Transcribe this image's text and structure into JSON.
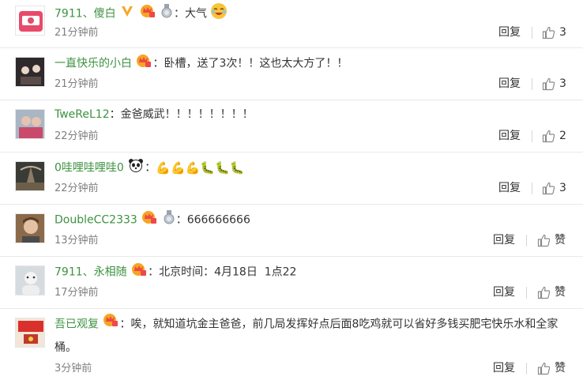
{
  "comments": [
    {
      "username": "7911、傻白",
      "separator": "：",
      "text": "大气",
      "time": "21分钟前",
      "reply_label": "回复",
      "like_count": "3"
    },
    {
      "username": "一直快乐的小白",
      "separator": "：",
      "text": "卧槽，送了3次！！这也太大方了！！",
      "time": "21分钟前",
      "reply_label": "回复",
      "like_count": "3"
    },
    {
      "username": "TweReL12",
      "separator": "：",
      "text": "金爸威武！！！！！！！！",
      "time": "22分钟前",
      "reply_label": "回复",
      "like_count": "2"
    },
    {
      "username": "0哇哩哇哩哇0",
      "separator": "：",
      "text": "",
      "emoji_text": "💪💪💪🐛🐛🐛",
      "time": "22分钟前",
      "reply_label": "回复",
      "like_count": "3"
    },
    {
      "username": "DoubleCC2333",
      "separator": "：",
      "text": "666666666",
      "time": "13分钟前",
      "reply_label": "回复",
      "like_count": "赞"
    },
    {
      "username": "7911、永相随",
      "separator": "：",
      "text": "北京时间：4月18日  1点22",
      "time": "17分钟前",
      "reply_label": "回复",
      "like_count": "赞"
    },
    {
      "username": "吾已观复",
      "separator": "：",
      "text": "唉，就知道坑金主爸爸，前几局发挥好点后面8吃鸡就可以省好多钱买肥宅快乐水和全家桶。",
      "time": "3分钟前",
      "reply_label": "回复",
      "like_count": "赞"
    }
  ],
  "colors": {
    "username": "#3d9240",
    "time": "#808080",
    "divider": "#e9e9e9",
    "vip_badge": "#f5a623",
    "member_badge": "#f04848"
  }
}
